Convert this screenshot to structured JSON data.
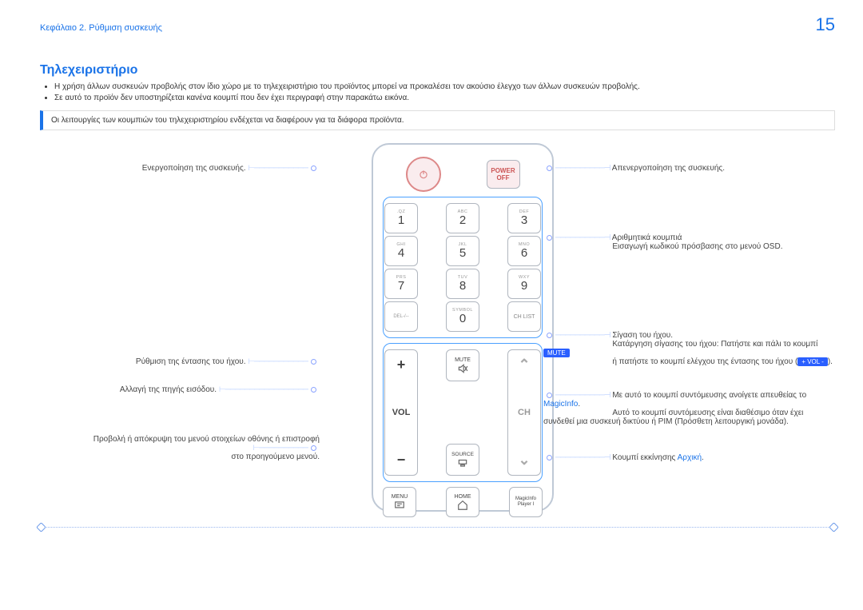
{
  "header": {
    "chapter": "Κεφάλαιο 2. Ρύθμιση συσκευής",
    "page": "15"
  },
  "section": {
    "title": "Τηλεχειριστήριο",
    "bullets": [
      "Η χρήση άλλων συσκευών προβολής στον ίδιο χώρο με το τηλεχειριστήριο του προϊόντος μπορεί να προκαλέσει τον ακούσιο έλεγχο των άλλων συσκευών προβολής.",
      "Σε αυτό το προϊόν δεν υποστηρίζεται κανένα κουμπί που δεν έχει περιγραφή στην παρακάτω εικόνα."
    ],
    "note": "Οι λειτουργίες των κουμπιών του τηλεχειριστηρίου ενδέχεται να διαφέρουν για τα διάφορα προϊόντα."
  },
  "remote": {
    "power_off_top": "POWER",
    "power_off_bottom": "OFF",
    "keys": {
      "subs": {
        "1": ".QZ",
        "2": "ABC",
        "3": "DEF",
        "4": "GHI",
        "5": "JKL",
        "6": "MNO",
        "7": "PRS",
        "8": "TUV",
        "9": "WXY",
        "0": "SYMBOL",
        "del": "DEL-/--"
      },
      "nums": {
        "1": "1",
        "2": "2",
        "3": "3",
        "4": "4",
        "5": "5",
        "6": "6",
        "7": "7",
        "8": "8",
        "9": "9",
        "0": "0"
      },
      "chlist": "CH LIST",
      "vol": "VOL",
      "ch": "CH",
      "mute": "MUTE",
      "source": "SOURCE",
      "menu": "MENU",
      "home": "HOME",
      "magic_top": "MagicInfo",
      "magic_bot": "Player I"
    }
  },
  "labels": {
    "left": {
      "power_on": "Ενεργοποίηση της συσκευής.",
      "volume": "Ρύθμιση της έντασης του ήχου.",
      "source": "Αλλαγή της πηγής εισόδου.",
      "menu_top": "Προβολή ή απόκρυψη του μενού στοιχείων οθόνης ή επιστροφή",
      "menu_bot": "στο προηγούμενο μενού."
    },
    "right": {
      "power_off": "Απενεργοποίηση της συσκευής.",
      "nums": "Αριθμητικά κουμπιά",
      "nums_sub": "Εισαγωγή κωδικού πρόσβασης στο μενού OSD.",
      "mute": "Σίγαση του ήχου.",
      "mute2_pre": "Κατάργηση σίγασης του ήχου: Πατήστε και πάλι το κουμπί ",
      "mute2_badge": "MUTE",
      "mute3_pre": "ή πατήστε το κουμπί ελέγχου της έντασης του ήχου (",
      "mute3_badge": "+ VOL -",
      "mute3_post": ").",
      "magic1": "Με αυτό το κουμπί συντόμευσης ανοίγετε απευθείας το ",
      "magic_link": "MagicInfo",
      "magic_dot": ".",
      "magic2": "Αυτό το κουμπί συντόμευσης είναι διαθέσιμο όταν έχει συνδεθεί μια συσκευή δικτύου ή PIM (Πρόσθετη λειτουργική μονάδα).",
      "home": "Κουμπί εκκίνησης ",
      "home_link": "Αρχική",
      "home_dot": "."
    }
  }
}
